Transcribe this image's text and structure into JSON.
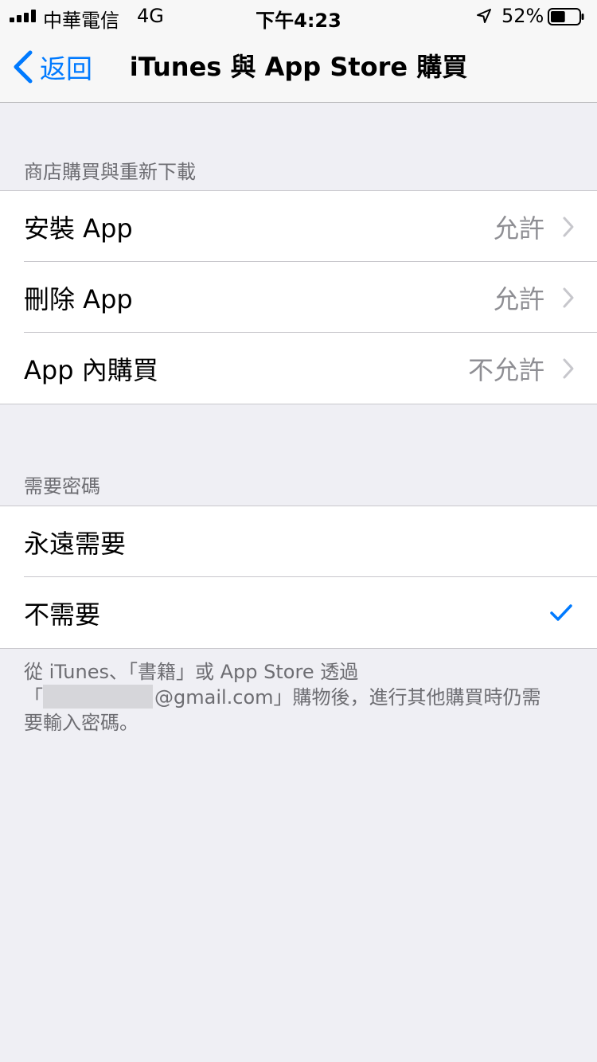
{
  "status_bar": {
    "carrier": "中華電信",
    "network": "4G",
    "time": "下午4:23",
    "battery_percent": "52%",
    "battery_level": 0.52
  },
  "nav": {
    "back_label": "返回",
    "title": "iTunes 與 App Store 購買"
  },
  "section1": {
    "header": "商店購買與重新下載",
    "rows": [
      {
        "label": "安裝 App",
        "value": "允許"
      },
      {
        "label": "刪除 App",
        "value": "允許"
      },
      {
        "label": "App 內購買",
        "value": "不允許"
      }
    ]
  },
  "section2": {
    "header": "需要密碼",
    "rows": [
      {
        "label": "永遠需要",
        "selected": false
      },
      {
        "label": "不需要",
        "selected": true
      }
    ]
  },
  "footer": {
    "line1": "從 iTunes、「書籍」或 App Store 透過",
    "line2_prefix": "「",
    "line2_suffix": "@gmail.com」購物後，進行其他購買時仍需",
    "line3": "要輸入密碼。"
  },
  "colors": {
    "accent": "#007aff",
    "background": "#efeff4",
    "secondary_text": "#8e8e93"
  }
}
